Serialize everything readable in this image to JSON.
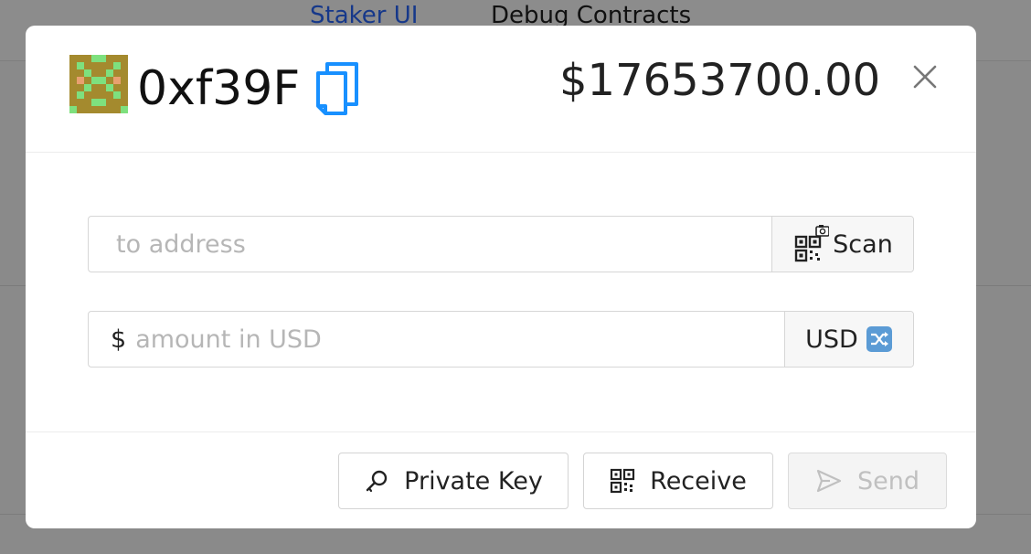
{
  "background": {
    "nav_tabs": [
      {
        "label": "Staker UI",
        "active": true
      },
      {
        "label": "Debug Contracts",
        "active": false
      }
    ]
  },
  "modal": {
    "address_short": "0xf39F",
    "balance": "$17653700.00",
    "to_address": {
      "value": "",
      "placeholder": "to address",
      "scan_label": "Scan"
    },
    "amount": {
      "prefix": "$",
      "value": "",
      "placeholder": "amount in USD",
      "currency_label": "USD"
    },
    "buttons": {
      "private_key": "Private Key",
      "receive": "Receive",
      "send": "Send"
    }
  },
  "icons": {
    "copy": "copy-icon",
    "close": "close-icon",
    "scan": "qr-scan-icon",
    "swap": "shuffle-icon",
    "key": "key-icon",
    "qr": "qrcode-icon",
    "send": "send-icon"
  },
  "colors": {
    "accent": "#1890ff",
    "backdrop": "#8a8a8a",
    "active_tab": "#16388a"
  }
}
